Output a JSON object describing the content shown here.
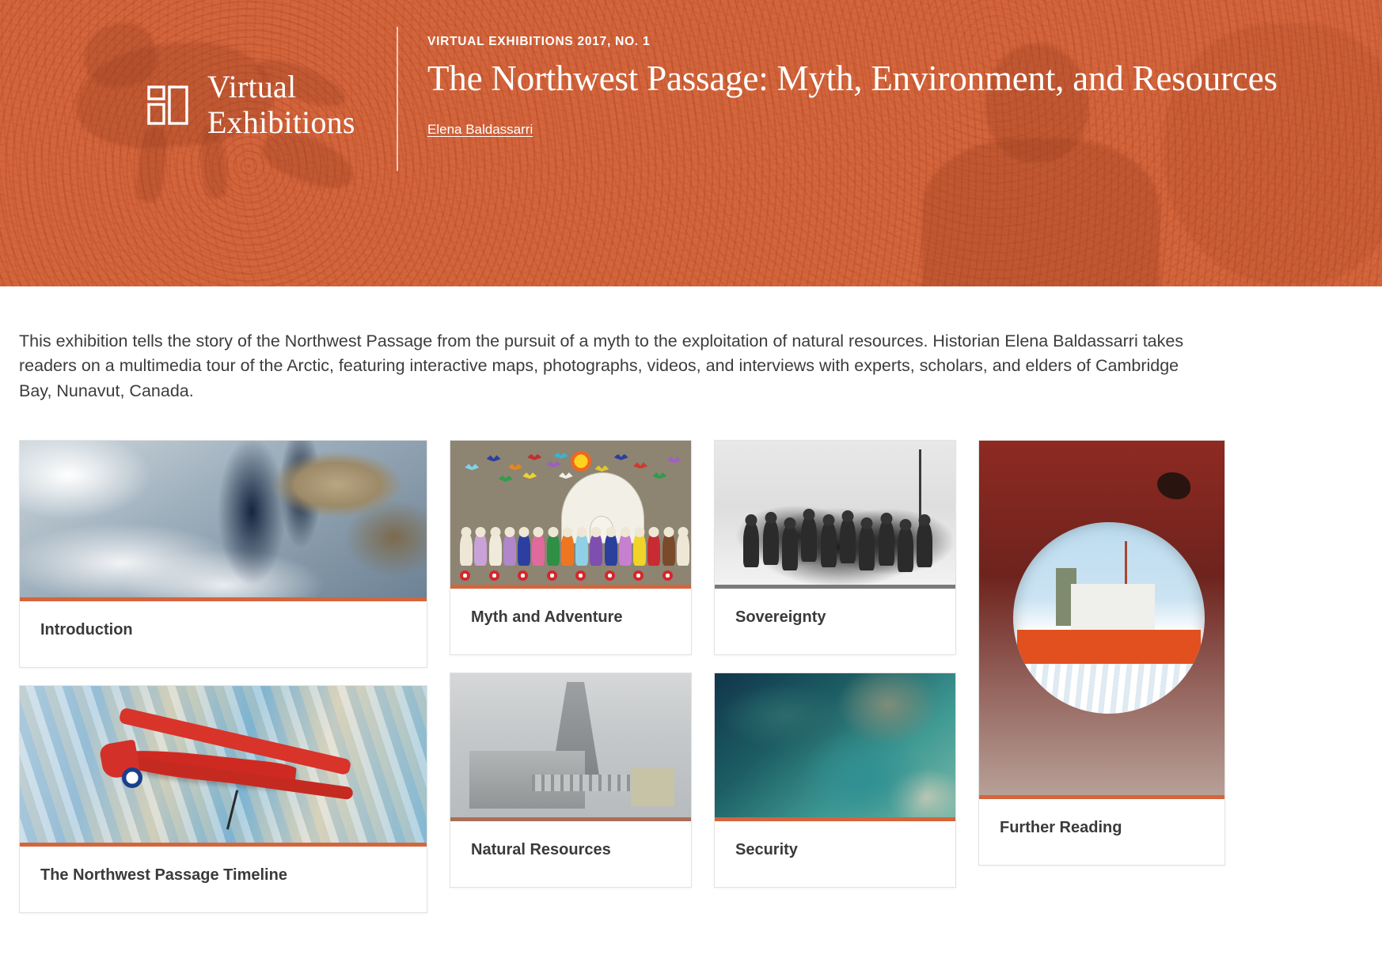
{
  "masthead": {
    "brand_name": "Virtual\nExhibitions",
    "brand_logo_icon": "three-panel-logo-icon",
    "kicker": "VIRTUAL EXHIBITIONS 2017, NO. 1",
    "title": "The Northwest Passage: Myth, Environment, and Resources",
    "author": "Elena Baldassarri",
    "accent_color": "#d4653c",
    "text_color": "#ffffff"
  },
  "intro": {
    "paragraph": "This exhibition tells the story of the Northwest Passage from the pursuit of a myth to the exploitation of natural resources. Historian Elena Baldassarri takes readers on a multimedia tour of the Arctic, featuring interactive maps, photographs, videos, and interviews with experts, scholars, and elders of Cambridge Bay, Nunavut, Canada."
  },
  "cards": {
    "column_1": [
      {
        "title": "Introduction",
        "image": "satellite-arctic-ice-photo"
      },
      {
        "title": "The Northwest Passage Timeline",
        "image": "red-bush-plane-over-ice-photo"
      }
    ],
    "column_2": [
      {
        "title": "Myth and Adventure",
        "image": "felt-artwork-igloo-and-people"
      },
      {
        "title": "Natural Resources",
        "image": "abandoned-mine-industrial-photo"
      }
    ],
    "column_3": [
      {
        "title": "Sovereignty",
        "image": "historic-group-photo-in-snow"
      },
      {
        "title": "Security",
        "image": "aerial-turquoise-ocean-photo"
      }
    ],
    "column_4": [
      {
        "title": "Further Reading",
        "image": "icebreaker-ship-through-porthole-photo"
      }
    ]
  }
}
